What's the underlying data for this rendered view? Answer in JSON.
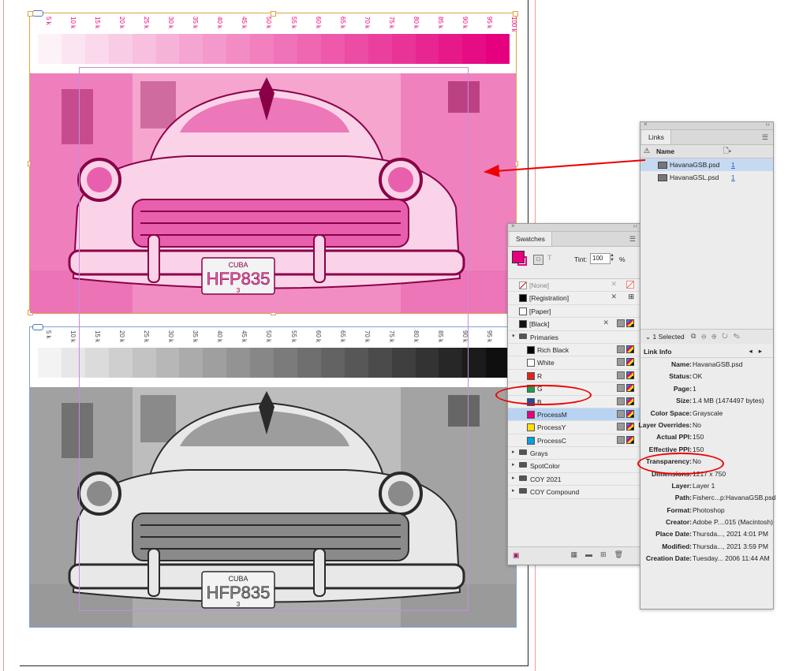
{
  "scale_labels": [
    "5 k",
    "10 k",
    "15 k",
    "20 k",
    "25 k",
    "30 k",
    "35 k",
    "40 k",
    "45 k",
    "50 k",
    "55 k",
    "60 k",
    "65 k",
    "70 k",
    "75 k",
    "80 k",
    "85 k",
    "90 k",
    "95 k",
    "100 k"
  ],
  "plate_text": "HFP835",
  "plate_top": "CUBA",
  "plate_bottom": "3",
  "colors": {
    "magenta": "#e5007e",
    "annotation": "#e00000",
    "selection": "#b8d3f2"
  },
  "links_panel": {
    "tab": "Links",
    "column_name": "Name",
    "rows": [
      {
        "name": "HavanaGSB.psd",
        "page": "1",
        "selected": true
      },
      {
        "name": "HavanaGSL.psd",
        "page": "1",
        "selected": false
      }
    ],
    "status": "1 Selected",
    "info_title": "Link Info",
    "info": [
      {
        "k": "Name:",
        "v": "HavanaGSB.psd"
      },
      {
        "k": "Status:",
        "v": "OK"
      },
      {
        "k": "Page:",
        "v": "1"
      },
      {
        "k": "Size:",
        "v": "1.4 MB (1474497 bytes)"
      },
      {
        "k": "Color Space:",
        "v": "Grayscale"
      },
      {
        "k": "Layer Overrides:",
        "v": "No"
      },
      {
        "k": "Actual PPI:",
        "v": "150"
      },
      {
        "k": "Effective PPI:",
        "v": "150"
      },
      {
        "k": "Transparency:",
        "v": "No"
      },
      {
        "k": "Dimensions:",
        "v": "1217 x 750"
      },
      {
        "k": "Layer:",
        "v": "Layer 1"
      },
      {
        "k": "Path:",
        "v": "Fisherc...p:HavanaGSB.psd"
      },
      {
        "k": "Format:",
        "v": "Photoshop"
      },
      {
        "k": "Creator:",
        "v": "Adobe P....015 (Macintosh)"
      },
      {
        "k": "Place Date:",
        "v": "Thursda..., 2021 4:01 PM"
      },
      {
        "k": "Modified:",
        "v": "Thursda..., 2021 3:59 PM"
      },
      {
        "k": "Creation Date:",
        "v": "Tuesday... 2006 11:44 AM"
      }
    ]
  },
  "swatches_panel": {
    "tab": "Swatches",
    "tint_label": "Tint:",
    "tint_value": "100",
    "tint_unit": "%",
    "rows": [
      {
        "name": "[None]",
        "color": "none",
        "indent": 0,
        "kind": "none"
      },
      {
        "name": "[Registration]",
        "color": "#000000",
        "indent": 0,
        "kind": "reg"
      },
      {
        "name": "[Paper]",
        "color": "#ffffff",
        "indent": 0,
        "kind": "plain"
      },
      {
        "name": "[Black]",
        "color": "#111111",
        "indent": 0,
        "kind": "black"
      },
      {
        "name": "Primaries",
        "color": "",
        "indent": 0,
        "kind": "group-open"
      },
      {
        "name": "Rich Black",
        "color": "#000000",
        "indent": 1,
        "kind": "swatch"
      },
      {
        "name": "White",
        "color": "#ffffff",
        "indent": 1,
        "kind": "swatch"
      },
      {
        "name": "R",
        "color": "#e2231a",
        "indent": 1,
        "kind": "swatch"
      },
      {
        "name": "G",
        "color": "#17a34a",
        "indent": 1,
        "kind": "swatch"
      },
      {
        "name": "B",
        "color": "#1d4fa6",
        "indent": 1,
        "kind": "swatch"
      },
      {
        "name": "ProcessM",
        "color": "#e5007e",
        "indent": 1,
        "kind": "swatch",
        "selected": true
      },
      {
        "name": "ProcessY",
        "color": "#ffe100",
        "indent": 1,
        "kind": "swatch"
      },
      {
        "name": "ProcessC",
        "color": "#009fe3",
        "indent": 1,
        "kind": "swatch"
      },
      {
        "name": "Grays",
        "color": "",
        "indent": 0,
        "kind": "group"
      },
      {
        "name": "SpotColor",
        "color": "",
        "indent": 0,
        "kind": "group"
      },
      {
        "name": "COY 2021",
        "color": "",
        "indent": 0,
        "kind": "group"
      },
      {
        "name": "COY Compound",
        "color": "",
        "indent": 0,
        "kind": "group"
      }
    ]
  }
}
